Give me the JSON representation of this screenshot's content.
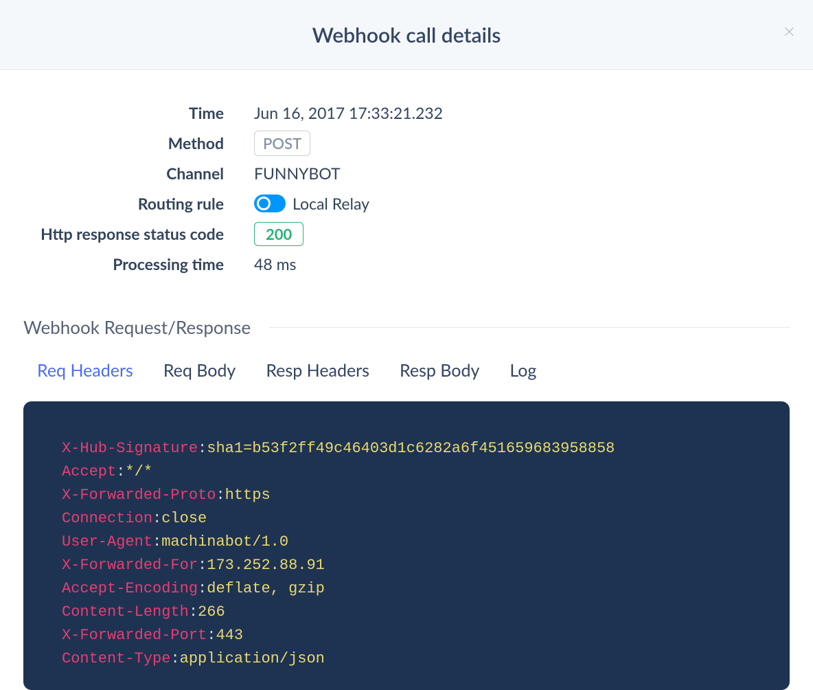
{
  "header": {
    "title": "Webhook call details"
  },
  "details": {
    "labels": {
      "time": "Time",
      "method": "Method",
      "channel": "Channel",
      "routing_rule": "Routing rule",
      "status_code": "Http response status code",
      "processing_time": "Processing time"
    },
    "time": "Jun 16, 2017 17:33:21.232",
    "method": "POST",
    "channel": "FUNNYBOT",
    "routing_rule": "Local Relay",
    "status_code": "200",
    "processing_time": "48 ms"
  },
  "section_title": "Webhook Request/Response",
  "tabs": {
    "req_headers": "Req Headers",
    "req_body": "Req Body",
    "resp_headers": "Resp Headers",
    "resp_body": "Resp Body",
    "log": "Log"
  },
  "req_headers": [
    {
      "key": "X-Hub-Signature",
      "value": "sha1=b53f2ff49c46403d1c6282a6f451659683958858"
    },
    {
      "key": "Accept",
      "value": "*/*"
    },
    {
      "key": "X-Forwarded-Proto",
      "value": "https"
    },
    {
      "key": "Connection",
      "value": "close"
    },
    {
      "key": "User-Agent",
      "value": "machinabot/1.0"
    },
    {
      "key": "X-Forwarded-For",
      "value": "173.252.88.91"
    },
    {
      "key": "Accept-Encoding",
      "value": "deflate, gzip"
    },
    {
      "key": "Content-Length",
      "value": "266"
    },
    {
      "key": "X-Forwarded-Port",
      "value": "443"
    },
    {
      "key": "Content-Type",
      "value": "application/json"
    }
  ]
}
